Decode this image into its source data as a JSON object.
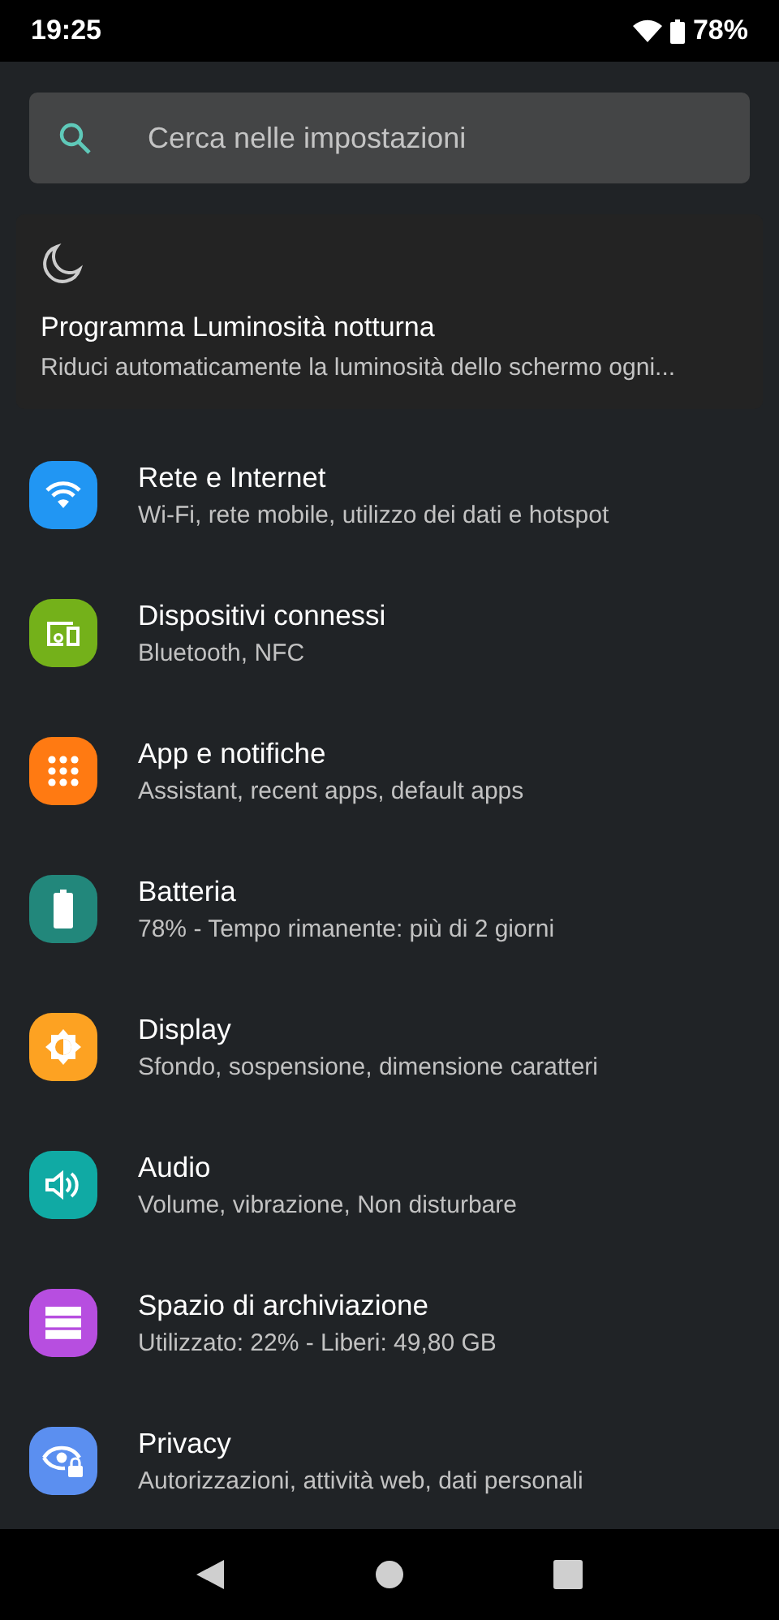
{
  "status_bar": {
    "time": "19:25",
    "battery": "78%"
  },
  "search": {
    "placeholder": "Cerca nelle impostazioni"
  },
  "suggestion": {
    "title": "Programma Luminosità notturna",
    "subtitle": "Riduci automaticamente la luminosità dello schermo ogni..."
  },
  "items": [
    {
      "kind": "wifi",
      "color": "#2196f3",
      "title": "Rete e Internet",
      "subtitle": "Wi-Fi, rete mobile, utilizzo dei dati e hotspot"
    },
    {
      "kind": "devices",
      "color": "#74b11a",
      "title": "Dispositivi connessi",
      "subtitle": "Bluetooth, NFC"
    },
    {
      "kind": "apps",
      "color": "#ff7a12",
      "title": "App e notifiche",
      "subtitle": "Assistant, recent apps, default apps"
    },
    {
      "kind": "battery",
      "color": "#22877b",
      "title": "Batteria",
      "subtitle": "78% - Tempo rimanente: più di 2 giorni"
    },
    {
      "kind": "display",
      "color": "#fda222",
      "title": "Display",
      "subtitle": "Sfondo, sospensione, dimensione caratteri"
    },
    {
      "kind": "audio",
      "color": "#10aaa4",
      "title": "Audio",
      "subtitle": "Volume, vibrazione, Non disturbare"
    },
    {
      "kind": "storage",
      "color": "#b74ee0",
      "title": "Spazio di archiviazione",
      "subtitle": "Utilizzato: 22% - Liberi: 49,80 GB"
    },
    {
      "kind": "privacy",
      "color": "#5b8ff0",
      "title": "Privacy",
      "subtitle": "Autorizzazioni, attività web, dati personali"
    }
  ]
}
